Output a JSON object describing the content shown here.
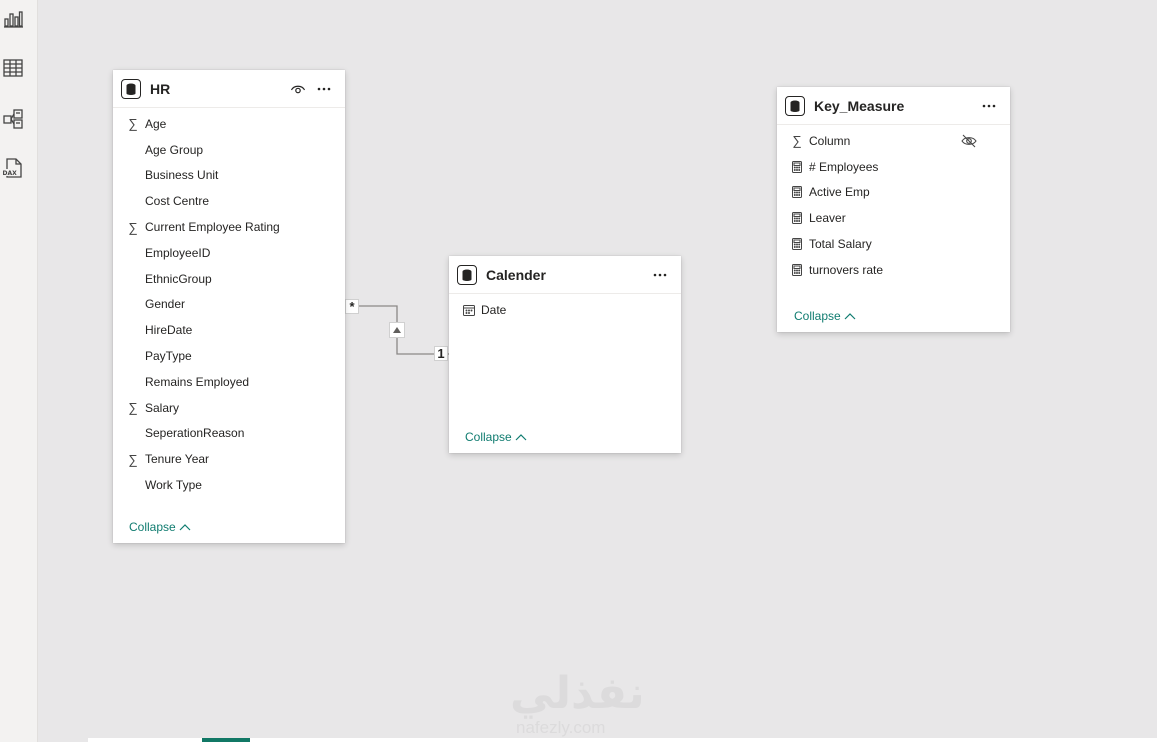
{
  "left_nav": {
    "icons": [
      "report-view-icon",
      "table-view-icon",
      "model-view-icon",
      "dax-query-view-icon"
    ],
    "dax_label": "DAX"
  },
  "tables": {
    "hr": {
      "title": "HR",
      "fields": [
        {
          "name": "Age",
          "icon": "sigma"
        },
        {
          "name": "Age Group",
          "icon": "none"
        },
        {
          "name": "Business Unit",
          "icon": "none"
        },
        {
          "name": "Cost Centre",
          "icon": "none"
        },
        {
          "name": "Current Employee Rating",
          "icon": "sigma"
        },
        {
          "name": "EmployeeID",
          "icon": "none"
        },
        {
          "name": "EthnicGroup",
          "icon": "none"
        },
        {
          "name": "Gender",
          "icon": "none"
        },
        {
          "name": "HireDate",
          "icon": "none"
        },
        {
          "name": "PayType",
          "icon": "none"
        },
        {
          "name": "Remains Employed",
          "icon": "none"
        },
        {
          "name": "Salary",
          "icon": "sigma"
        },
        {
          "name": "SeperationReason",
          "icon": "none"
        },
        {
          "name": "Tenure Year",
          "icon": "sigma"
        },
        {
          "name": "Work Type",
          "icon": "none"
        }
      ],
      "collapse_label": "Collapse"
    },
    "calender": {
      "title": "Calender",
      "fields": [
        {
          "name": "Date",
          "icon": "calendar"
        }
      ],
      "collapse_label": "Collapse"
    },
    "key_measure": {
      "title": "Key_Measure",
      "fields": [
        {
          "name": "Column",
          "icon": "sigma"
        },
        {
          "name": "# Employees",
          "icon": "calculator"
        },
        {
          "name": "Active Emp",
          "icon": "calculator"
        },
        {
          "name": "Leaver",
          "icon": "calculator"
        },
        {
          "name": "Total Salary",
          "icon": "calculator"
        },
        {
          "name": "turnovers rate",
          "icon": "calculator"
        }
      ],
      "collapse_label": "Collapse"
    }
  },
  "relationship": {
    "from_table": "HR",
    "to_table": "Calender",
    "many_label": "*",
    "one_label": "1",
    "filter_direction": "single"
  },
  "watermark": {
    "text": "نفذلي",
    "sub": "nafezly.com"
  },
  "colors": {
    "canvas": "#e8e7e8",
    "card": "#ffffff",
    "collapse_link": "#107c70",
    "tab_accent": "#117865"
  }
}
